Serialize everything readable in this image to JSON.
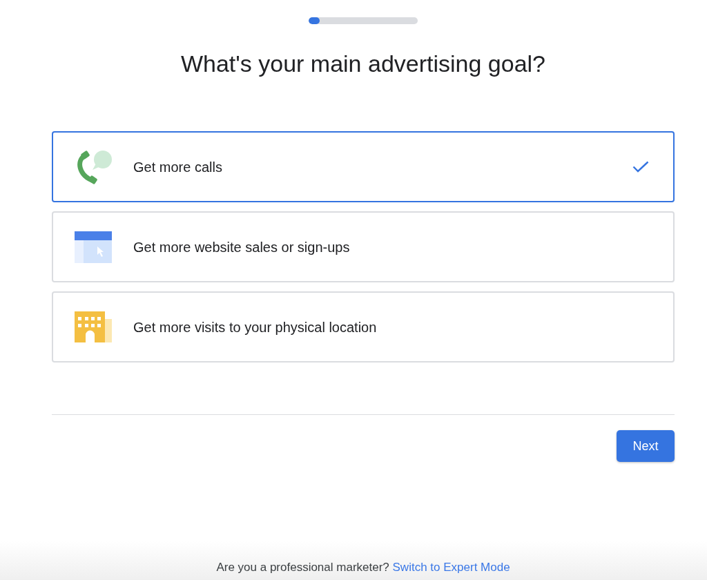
{
  "progress": {
    "level": 0.1
  },
  "title": "What's your main advertising goal?",
  "options": [
    {
      "kind": "calls",
      "label": "Get more calls",
      "selected": true
    },
    {
      "kind": "website",
      "label": "Get more website sales or sign-ups",
      "selected": false
    },
    {
      "kind": "visits",
      "label": "Get more visits to your physical location",
      "selected": false
    }
  ],
  "next_button": "Next",
  "footer": {
    "text": "Are you a professional marketer?",
    "link": "Switch to Expert Mode"
  }
}
